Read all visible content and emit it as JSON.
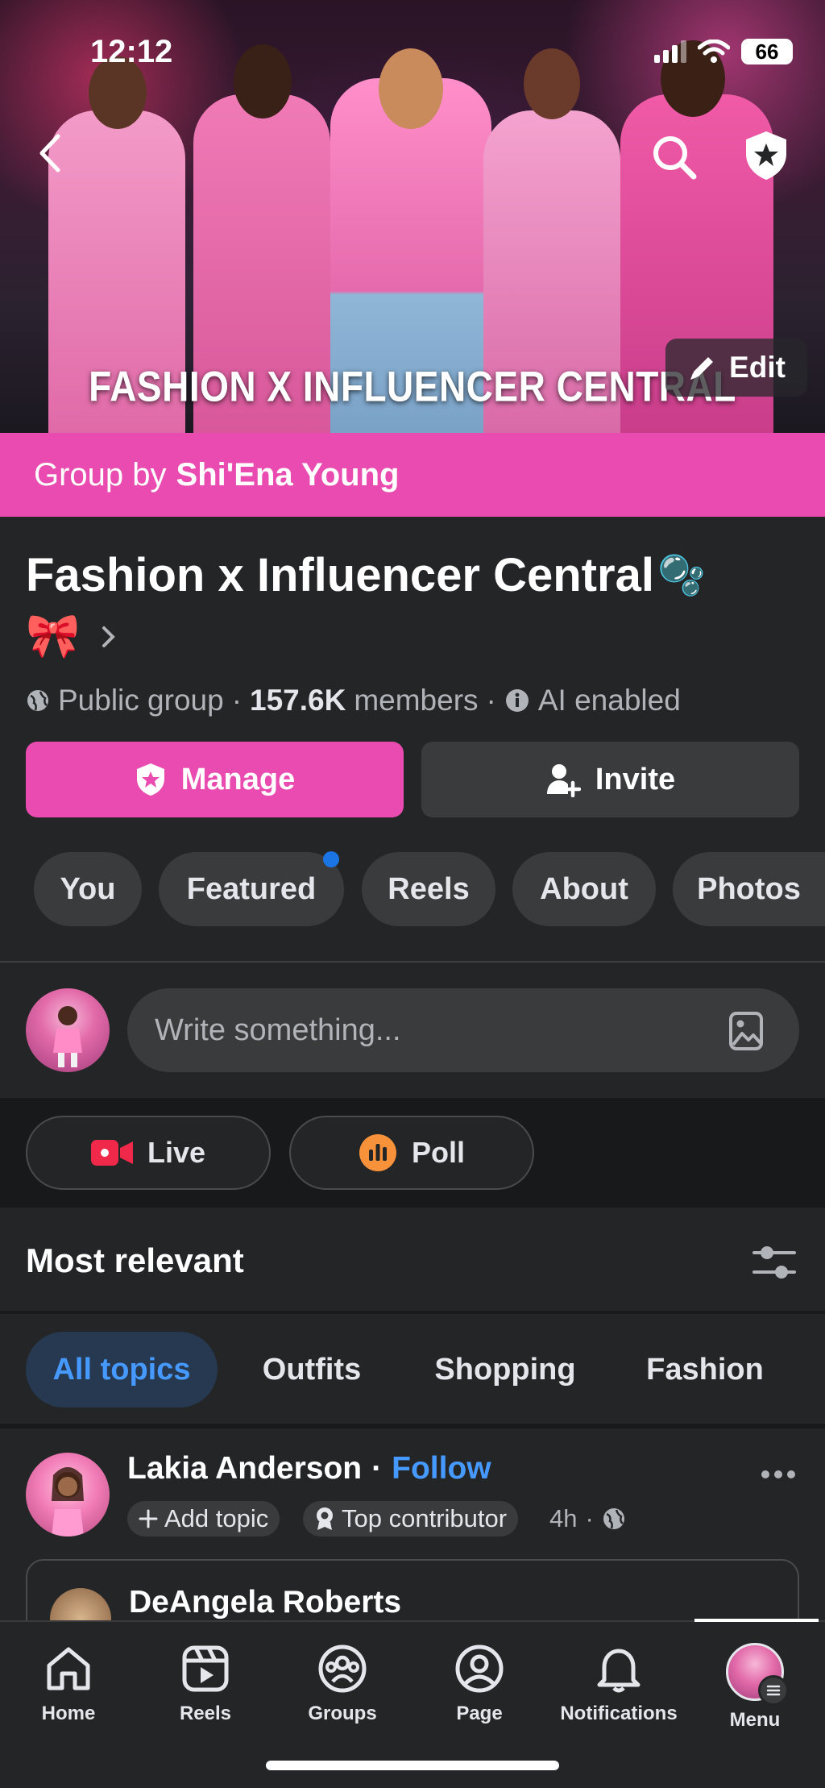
{
  "status_bar": {
    "time": "12:12",
    "battery": "66"
  },
  "cover": {
    "title": "FASHION X INFLUENCER CENTRAL",
    "edit_label": "Edit",
    "back_icon": "back-chevron-icon",
    "search_icon": "search-icon",
    "admin_icon": "admin-shield-icon"
  },
  "banner": {
    "prefix": "Group by",
    "owner": "Shi'Ena Young"
  },
  "group": {
    "name": "Fashion x Influencer Central",
    "emoji_bubbles": "🫧",
    "emoji_bow": "🎀",
    "privacy": "Public group",
    "members_count": "157.6K",
    "members_label": "members",
    "ai_label": "AI enabled"
  },
  "actions": {
    "manage_label": "Manage",
    "invite_label": "Invite"
  },
  "tabs": [
    {
      "label": "You"
    },
    {
      "label": "Featured"
    },
    {
      "label": "Reels"
    },
    {
      "label": "About"
    },
    {
      "label": "Photos"
    }
  ],
  "composer": {
    "placeholder": "Write something..."
  },
  "quick_actions": {
    "live_label": "Live",
    "poll_label": "Poll"
  },
  "feed": {
    "sort_label": "Most relevant",
    "topics": [
      {
        "label": "All topics",
        "active": true
      },
      {
        "label": "Outfits"
      },
      {
        "label": "Shopping"
      },
      {
        "label": "Fashion"
      }
    ]
  },
  "post": {
    "author": "Lakia Anderson",
    "separator": "·",
    "follow_label": "Follow",
    "add_topic_label": "Add topic",
    "badge_label": "Top contributor",
    "time": "4h",
    "time_separator": "·",
    "shared_author": "DeAngela Roberts"
  },
  "nav": {
    "items": [
      {
        "label": "Home"
      },
      {
        "label": "Reels"
      },
      {
        "label": "Groups"
      },
      {
        "label": "Page"
      },
      {
        "label": "Notifications"
      },
      {
        "label": "Menu"
      }
    ]
  },
  "colors": {
    "accent_pink": "#E94BB0",
    "link_blue": "#4599FF",
    "bg": "#242526"
  }
}
